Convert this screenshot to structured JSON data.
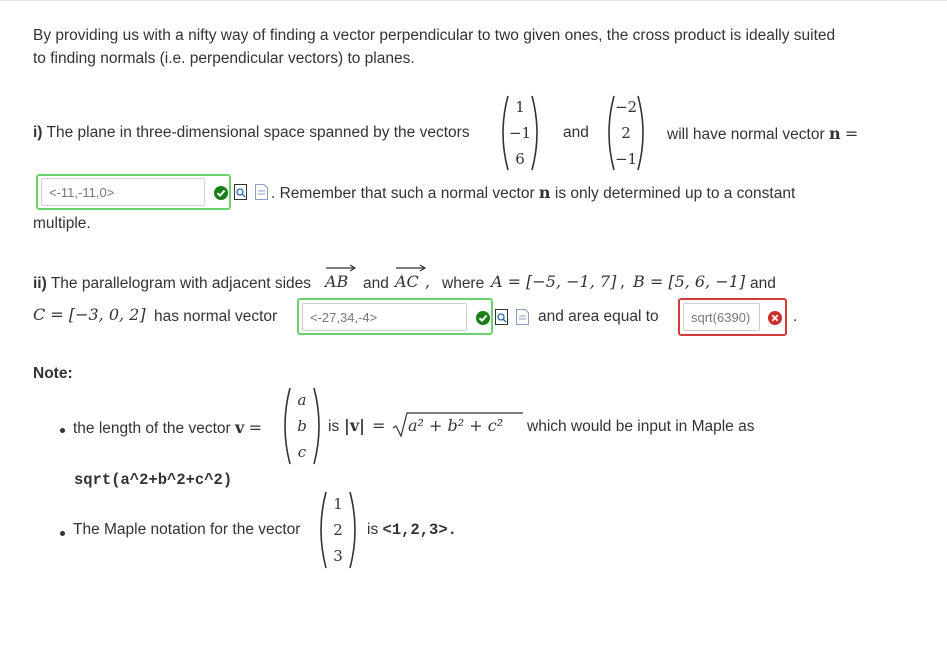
{
  "intro": {
    "line1": "By providing us with a nifty way of finding a vector perpendicular to two given ones, the cross product is ideally suited",
    "line2": "to finding normals (i.e. perpendicular vectors) to planes."
  },
  "part1": {
    "label": "i)",
    "text": "The plane in three-dimensional space spanned by the vectors",
    "vector1": [
      "1",
      "−1",
      "6"
    ],
    "and": "and",
    "vector2": [
      "−2",
      "2",
      "−1"
    ],
    "text_after": "will have normal vector",
    "n": "n",
    "eq": "=",
    "answer": "<-11,-11,0>",
    "remember_pre": ". Remember that such a normal vector",
    "remember_n": "n",
    "remember_post": "is only determined up to a constant",
    "multiple": "multiple."
  },
  "part2": {
    "label": "ii)",
    "text1": "The parallelogram with adjacent sides",
    "AB": "AB",
    "and": "and",
    "AC": "AC",
    "comma": ",",
    "where": "where",
    "A_def": "A = [−5, −1, 7]",
    "sep": ",",
    "B_def": "B = [5, 6, −1]",
    "and2": "and",
    "C_def": "C = [−3, 0, 2]",
    "has_normal": "has normal vector",
    "answer_normal": "<-27,34,-4>",
    "area_text": "and area equal to",
    "answer_area": "sqrt(6390)",
    "period": "."
  },
  "note": {
    "title": "Note:",
    "bullet1_pre": "the length of the vector",
    "v": "v",
    "eq": "=",
    "vector": [
      "a",
      "b",
      "c"
    ],
    "is": "is",
    "abs_v": "|v|",
    "eq2": "=",
    "sqrt_content": "a² + b² + c²",
    "bullet1_post": "which would be input in Maple as",
    "maple_code": "sqrt(a^2+b^2+c^2)",
    "bullet2_pre": "The Maple notation for the vector",
    "vector2": [
      "1",
      "2",
      "3"
    ],
    "bullet2_is": "is",
    "bullet2_code": "<1,2,3>."
  },
  "colors": {
    "correct": "#6bd36b",
    "incorrect": "#d43b3b",
    "check": "#1a7f1a",
    "cross": "#c9302c"
  }
}
